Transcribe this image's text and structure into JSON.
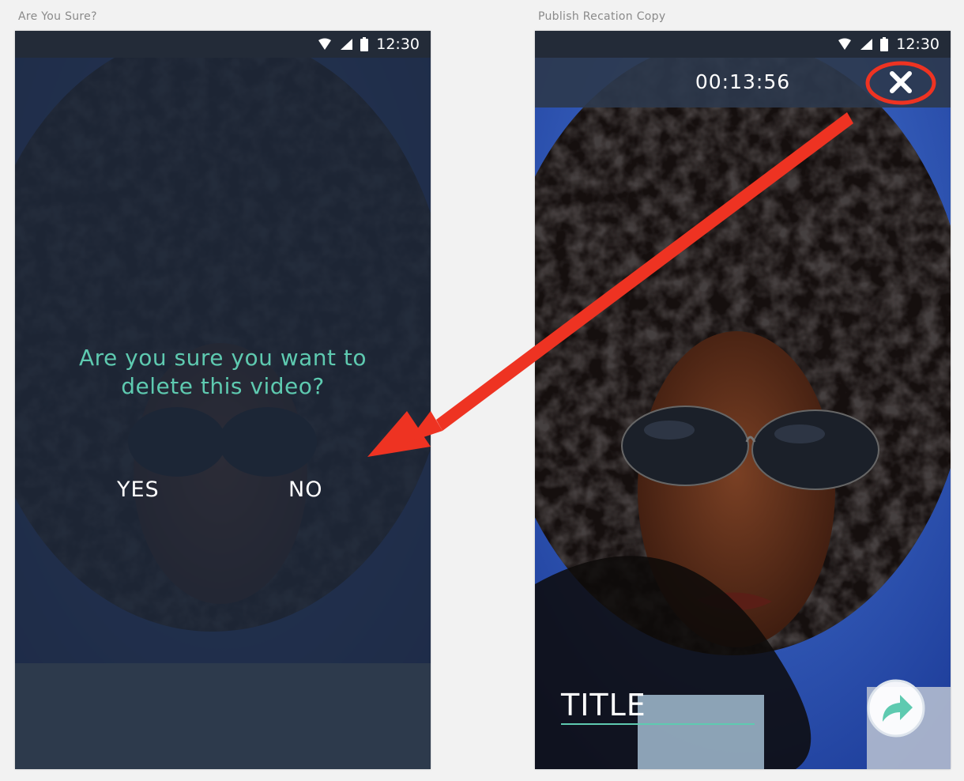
{
  "artboards": {
    "left_title": "Are You Sure?",
    "right_title": "Publish Recation Copy"
  },
  "status_bar": {
    "time": "12:30",
    "icons": [
      "wifi-icon",
      "signal-icon",
      "battery-icon"
    ]
  },
  "delete_dialog": {
    "question_line1": "Are you sure you want to",
    "question_line2": "delete this video?",
    "yes_label": "YES",
    "no_label": "NO"
  },
  "publish_screen": {
    "timer": "00:13:56",
    "close_icon": "close-icon",
    "title_placeholder": "TITLE",
    "share_icon": "share-arrow-icon"
  },
  "colors": {
    "accent": "#5ecab0",
    "status_bar": "#232b38",
    "overlay": "#1e293a",
    "annotation_red": "#ee3322"
  }
}
